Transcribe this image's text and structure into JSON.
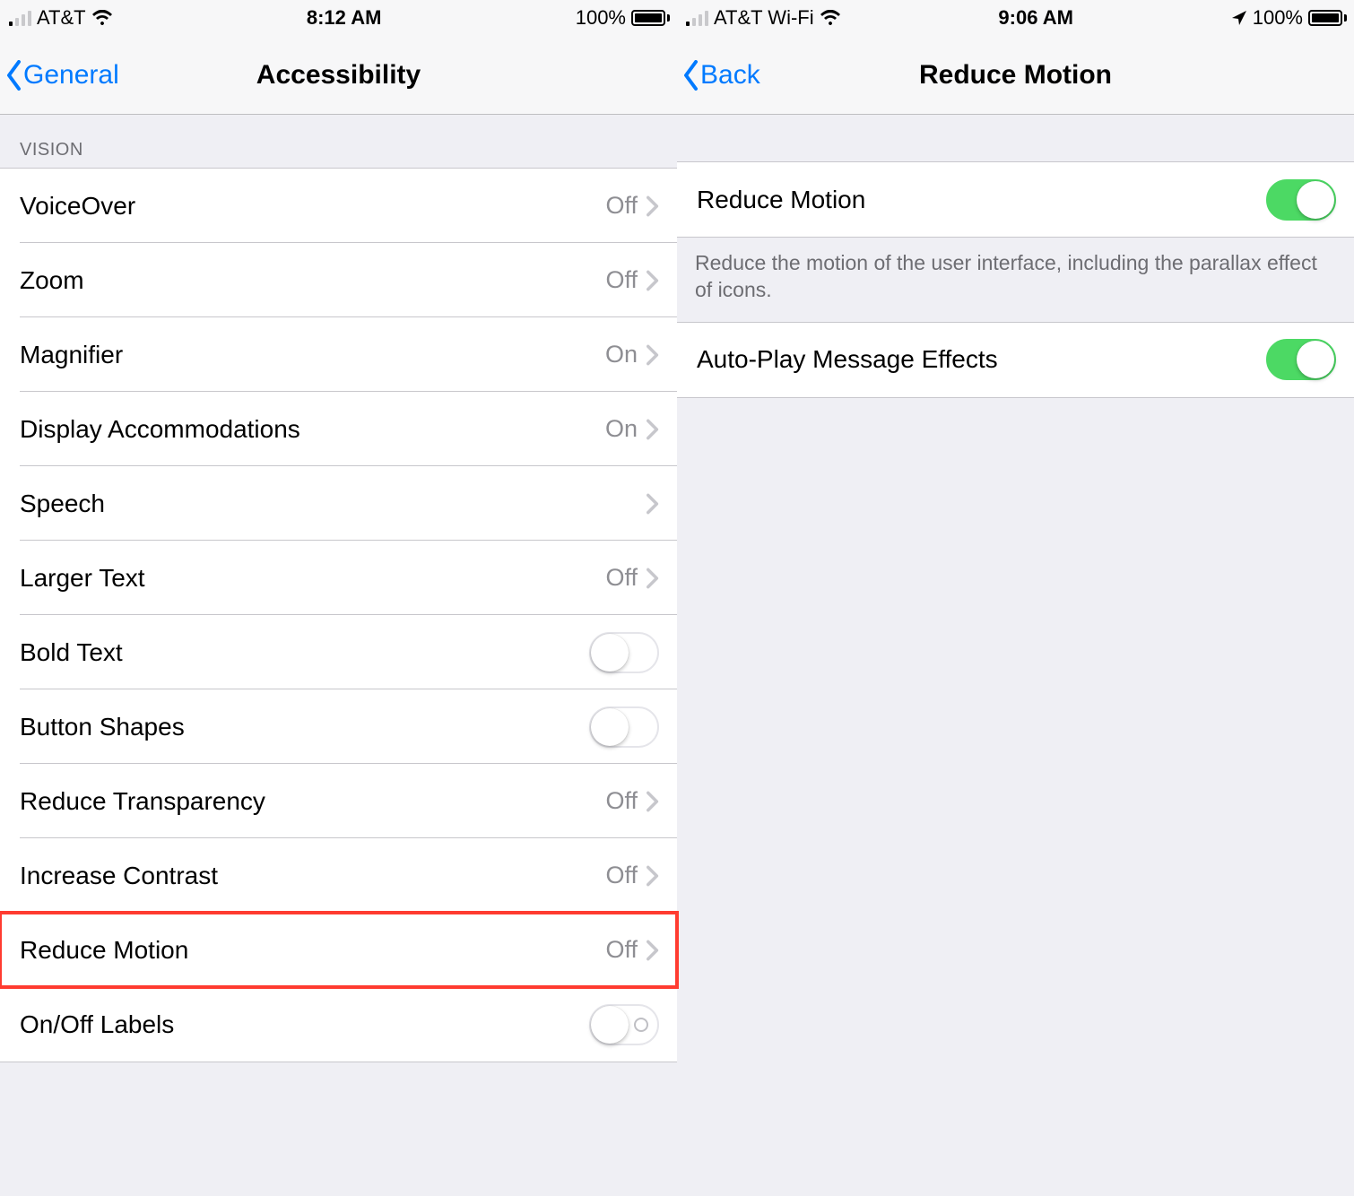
{
  "left": {
    "statusbar": {
      "carrier": "AT&T",
      "time": "8:12 AM",
      "battery_pct": "100%",
      "show_location": false,
      "signal_strength": 1
    },
    "nav": {
      "back_label": "General",
      "title": "Accessibility"
    },
    "section_header": "VISION",
    "rows": [
      {
        "label": "VoiceOver",
        "value": "Off",
        "type": "disclosure"
      },
      {
        "label": "Zoom",
        "value": "Off",
        "type": "disclosure"
      },
      {
        "label": "Magnifier",
        "value": "On",
        "type": "disclosure"
      },
      {
        "label": "Display Accommodations",
        "value": "On",
        "type": "disclosure"
      },
      {
        "label": "Speech",
        "value": "",
        "type": "disclosure"
      },
      {
        "label": "Larger Text",
        "value": "Off",
        "type": "disclosure"
      },
      {
        "label": "Bold Text",
        "value": "",
        "type": "toggle",
        "on": false
      },
      {
        "label": "Button Shapes",
        "value": "",
        "type": "toggle",
        "on": false
      },
      {
        "label": "Reduce Transparency",
        "value": "Off",
        "type": "disclosure"
      },
      {
        "label": "Increase Contrast",
        "value": "Off",
        "type": "disclosure"
      },
      {
        "label": "Reduce Motion",
        "value": "Off",
        "type": "disclosure"
      },
      {
        "label": "On/Off Labels",
        "value": "",
        "type": "toggle",
        "on": false,
        "indicator": true
      }
    ],
    "highlight_row_index": 10
  },
  "right": {
    "statusbar": {
      "carrier": "AT&T Wi-Fi",
      "time": "9:06 AM",
      "battery_pct": "100%",
      "show_location": true,
      "signal_strength": 1
    },
    "nav": {
      "back_label": "Back",
      "title": "Reduce Motion"
    },
    "rows": [
      {
        "label": "Reduce Motion",
        "type": "toggle",
        "on": true
      }
    ],
    "footer": "Reduce the motion of the user interface, including the parallax effect of icons.",
    "rows2": [
      {
        "label": "Auto-Play Message Effects",
        "type": "toggle",
        "on": true
      }
    ]
  }
}
